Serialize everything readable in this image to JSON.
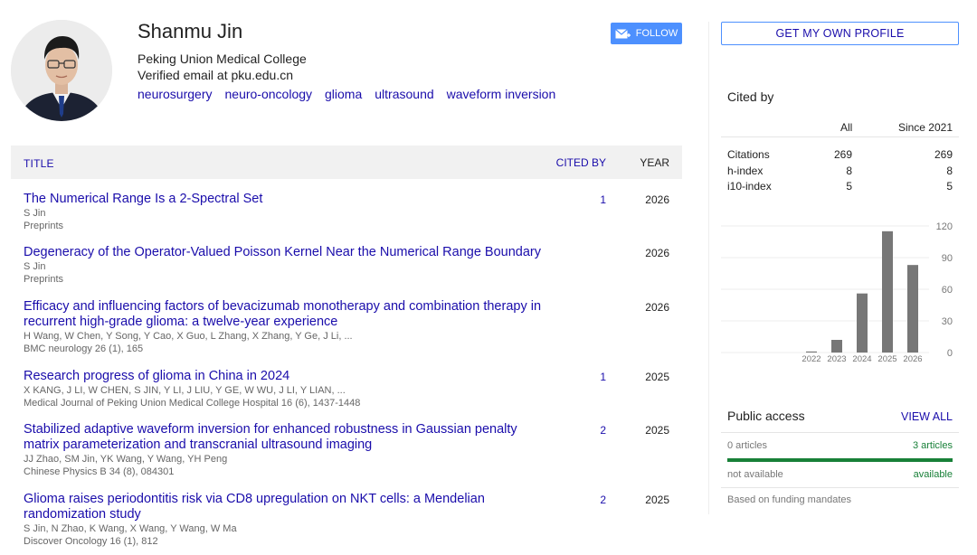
{
  "profile": {
    "name": "Shanmu Jin",
    "affiliation": "Peking Union Medical College",
    "email": "Verified email at pku.edu.cn",
    "interests": [
      "neurosurgery",
      "neuro-oncology",
      "glioma",
      "ultrasound",
      "waveform inversion"
    ],
    "follow_label": "FOLLOW"
  },
  "table": {
    "title_header": "TITLE",
    "cited_header": "CITED BY",
    "year_header": "YEAR"
  },
  "publications": [
    {
      "title": "The Numerical Range Is a 2-Spectral Set",
      "authors": "S Jin",
      "venue": "Preprints",
      "cited": "1",
      "year": "2026"
    },
    {
      "title": "Degeneracy of the Operator-Valued Poisson Kernel Near the Numerical Range Boundary",
      "authors": "S Jin",
      "venue": "Preprints",
      "cited": "",
      "year": "2026"
    },
    {
      "title": "Efficacy and influencing factors of bevacizumab monotherapy and combination therapy in recurrent high-grade glioma: a twelve-year experience",
      "authors": "H Wang, W Chen, Y Song, Y Cao, X Guo, L Zhang, X Zhang, Y Ge, J Li, ...",
      "venue": "BMC neurology 26 (1), 165",
      "cited": "",
      "year": "2026"
    },
    {
      "title": "Research progress of glioma in China in 2024",
      "authors": "X KANG, J LI, W CHEN, S JIN, Y LI, J LIU, Y GE, W WU, J LI, Y LIAN, ...",
      "venue": "Medical Journal of Peking Union Medical College Hospital 16 (6), 1437-1448",
      "cited": "1",
      "year": "2025"
    },
    {
      "title": "Stabilized adaptive waveform inversion for enhanced robustness in Gaussian penalty matrix parameterization and transcranial ultrasound imaging",
      "authors": "JJ Zhao, SM Jin, YK Wang, Y Wang, YH Peng",
      "venue": "Chinese Physics B 34 (8), 084301",
      "cited": "2",
      "year": "2025"
    },
    {
      "title": "Glioma raises periodontitis risk via CD8 upregulation on NKT cells: a Mendelian randomization study",
      "authors": "S Jin, N Zhao, K Wang, X Wang, Y Wang, W Ma",
      "venue": "Discover Oncology 16 (1), 812",
      "cited": "2",
      "year": "2025"
    }
  ],
  "sidebar": {
    "own_profile_label": "GET MY OWN PROFILE",
    "cited_by_heading": "Cited by",
    "col_all": "All",
    "col_since": "Since 2021",
    "rows": [
      {
        "label": "Citations",
        "all": "269",
        "since": "269"
      },
      {
        "label": "h-index",
        "all": "8",
        "since": "8"
      },
      {
        "label": "i10-index",
        "all": "5",
        "since": "5"
      }
    ],
    "public_access": {
      "heading": "Public access",
      "view_all": "VIEW ALL",
      "articles_left": "0 articles",
      "articles_right": "3 articles",
      "status_left": "not available",
      "status_right": "available",
      "note": "Based on funding mandates"
    }
  },
  "chart_data": {
    "type": "bar",
    "categories": [
      "2022",
      "2023",
      "2024",
      "2025",
      "2026"
    ],
    "values": [
      1,
      12,
      56,
      115,
      83
    ],
    "yticks": [
      0,
      30,
      60,
      90,
      120
    ],
    "ylim": [
      0,
      120
    ],
    "color": "#777777"
  }
}
